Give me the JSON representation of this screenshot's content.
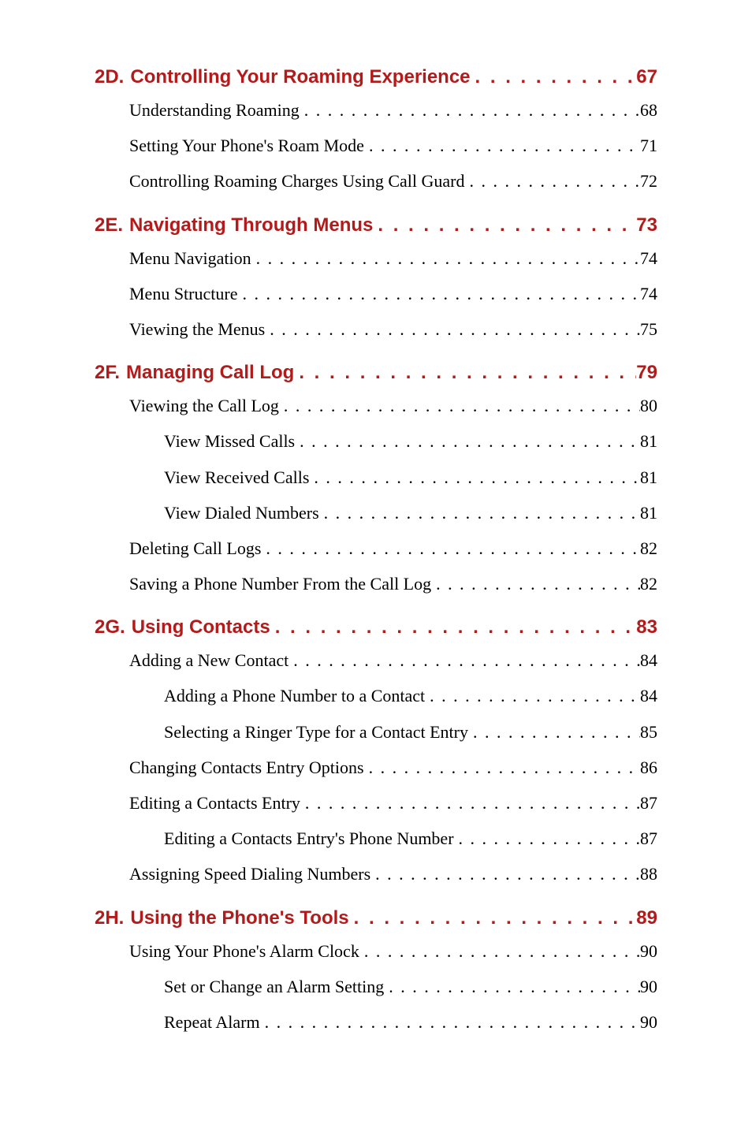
{
  "leader": ". . . . . . . . . . . . . . . . . . . . . . . . . . . . . . . . . . . . . . . . . . . . . . . . . . . . . . . . . . . . . . .",
  "sections": [
    {
      "prefix": "2D.",
      "title": "Controlling Your Roaming Experience",
      "page": "67",
      "items": [
        {
          "level": 1,
          "title": "Understanding Roaming",
          "page": "68"
        },
        {
          "level": 1,
          "title": "Setting Your Phone's Roam Mode",
          "page": "71"
        },
        {
          "level": 1,
          "title": "Controlling Roaming Charges Using Call Guard",
          "page": "72"
        }
      ]
    },
    {
      "prefix": "2E.",
      "title": "Navigating Through Menus",
      "page": "73",
      "items": [
        {
          "level": 1,
          "title": "Menu Navigation",
          "page": "74"
        },
        {
          "level": 1,
          "title": "Menu Structure",
          "page": "74"
        },
        {
          "level": 1,
          "title": "Viewing the Menus",
          "page": "75"
        }
      ]
    },
    {
      "prefix": "2F.",
      "title": "Managing Call Log",
      "page": "79",
      "items": [
        {
          "level": 1,
          "title": "Viewing the Call Log",
          "page": "80"
        },
        {
          "level": 2,
          "title": "View Missed Calls",
          "page": "81"
        },
        {
          "level": 2,
          "title": "View Received Calls",
          "page": "81"
        },
        {
          "level": 2,
          "title": "View Dialed Numbers",
          "page": "81"
        },
        {
          "level": 1,
          "title": "Deleting Call Logs",
          "page": "82"
        },
        {
          "level": 1,
          "title": "Saving a Phone Number From the Call Log",
          "page": "82"
        }
      ]
    },
    {
      "prefix": "2G.",
      "title": "Using Contacts",
      "page": "83",
      "items": [
        {
          "level": 1,
          "title": "Adding a New Contact",
          "page": "84"
        },
        {
          "level": 2,
          "title": "Adding a Phone Number to a Contact",
          "page": "84"
        },
        {
          "level": 2,
          "title": "Selecting a Ringer Type for a Contact Entry",
          "page": "85"
        },
        {
          "level": 1,
          "title": "Changing Contacts Entry Options",
          "page": "86"
        },
        {
          "level": 1,
          "title": "Editing a Contacts Entry",
          "page": "87"
        },
        {
          "level": 2,
          "title": "Editing a Contacts Entry's Phone Number",
          "page": "87"
        },
        {
          "level": 1,
          "title": "Assigning Speed Dialing Numbers",
          "page": "88"
        }
      ]
    },
    {
      "prefix": "2H.",
      "title": "Using the Phone's Tools",
      "page": "89",
      "items": [
        {
          "level": 1,
          "title": "Using Your Phone's Alarm Clock",
          "page": "90"
        },
        {
          "level": 2,
          "title": "Set or Change an Alarm Setting",
          "page": "90"
        },
        {
          "level": 2,
          "title": "Repeat Alarm",
          "page": "90"
        }
      ]
    }
  ]
}
